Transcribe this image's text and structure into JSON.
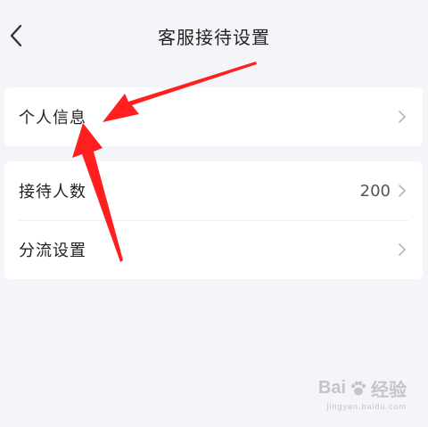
{
  "navbar": {
    "back_icon": "chevron-left-icon",
    "title": "客服接待设置"
  },
  "groups": [
    {
      "rows": [
        {
          "label": "个人信息",
          "value": "",
          "icon": "chevron-right-icon"
        }
      ]
    },
    {
      "rows": [
        {
          "label": "接待人数",
          "value": "200",
          "icon": "chevron-right-icon"
        },
        {
          "label": "分流设置",
          "value": "",
          "icon": "chevron-right-icon"
        }
      ]
    }
  ],
  "annotation": {
    "color": "#ff1f1f",
    "count": 2
  },
  "watermark": {
    "brand_left": "Bai",
    "brand_right": "经验",
    "url": "jingyan.baidu.com"
  },
  "colors": {
    "background": "#f4f5f9",
    "card": "#ffffff",
    "text": "#222222",
    "chevron": "#b5b5b5"
  }
}
